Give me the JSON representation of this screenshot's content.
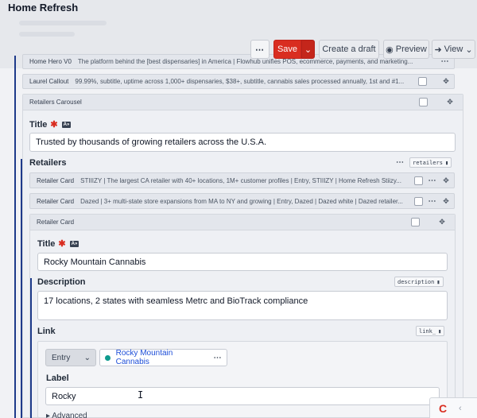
{
  "header": {
    "title": "Home Refresh"
  },
  "toolbar": {
    "more_label": "⋯",
    "save_label": "Save",
    "save_caret": "⌄",
    "draft_label": "Create a draft",
    "preview_label": "Preview",
    "preview_icon": "◉",
    "view_label": "View",
    "view_icon": "➜",
    "view_caret": "⌄"
  },
  "strips": {
    "hero": {
      "label": "Home Hero V0",
      "desc": "The platform behind the [best dispensaries] in America | Flowhub unifies POS, ecommerce, payments, and marketing..."
    },
    "laurel": {
      "label": "Laurel Callout",
      "desc": "99.99%, subtitle, uptime across 1,000+ dispensaries, $38+, subtitle, cannabis sales processed annually, 1st and #1..."
    }
  },
  "carousel": {
    "label": "Retailers Carousel",
    "title_label": "Title",
    "title_value": "Trusted by thousands of growing retailers across the U.S.A.",
    "retailers_label": "Retailers",
    "retailers_api": "retailers",
    "cards": [
      {
        "label": "Retailer Card",
        "desc": "STIIIZY | The largest CA retailer with 40+ locations, 1M+ customer profiles | Entry, STIIIZY | Home Refresh Stiizy..."
      },
      {
        "label": "Retailer Card",
        "desc": "Dazed | 3+ multi-state store expansions from MA to NY and growing | Entry, Dazed | Dazed white | Dazed retailer..."
      }
    ],
    "open_card": {
      "label": "Retailer Card",
      "title_label": "Title",
      "title_value": "Rocky Mountain Cannabis",
      "description_label": "Description",
      "description_api": "description",
      "description_value": "17 locations, 2 states with seamless Metrc and BioTrack compliance",
      "link_label": "Link",
      "link_api": "link_",
      "entry_type": "Entry",
      "entry_ref": "Rocky Mountain Cannabis",
      "label_label": "Label",
      "label_value": "Rocky",
      "advanced_label": "Advanced"
    }
  },
  "icons": {
    "dots": "⋯",
    "move": "✥",
    "lock": "🔒",
    "required": "✱",
    "multilang": "A»"
  }
}
